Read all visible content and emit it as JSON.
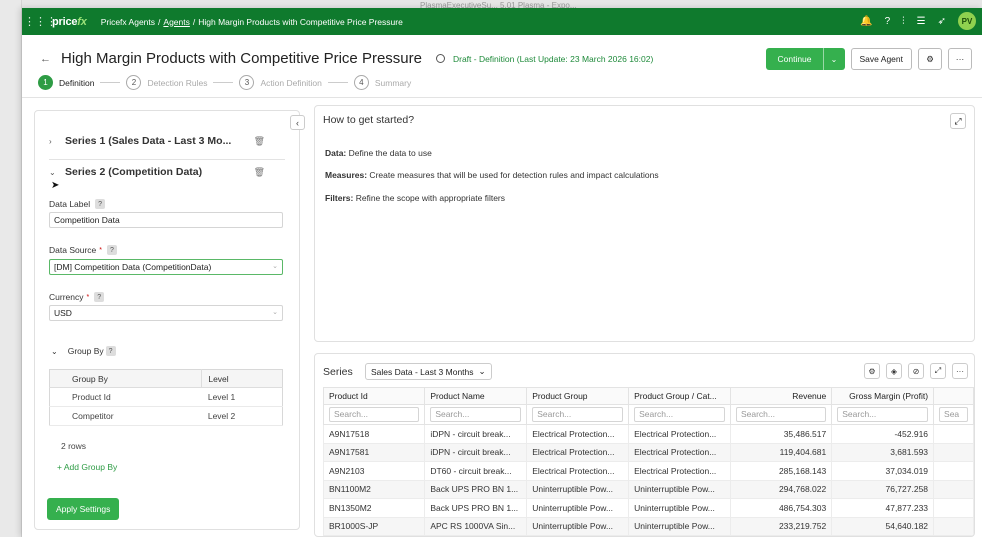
{
  "background_ghost_text": "PlasmaExecutiveSu...  5.01  Plasma - Expo...",
  "topbar": {
    "logo_main": "price",
    "logo_fx": "fx",
    "crumb_1": "Pricefx Agents",
    "crumb_sep1": "/",
    "crumb_2": "Agents",
    "crumb_sep2": "/",
    "crumb_3": "High Margin Products with Competitive Price Pressure",
    "avatar_initials": "PV",
    "icons": [
      "grid-icon",
      "bell-icon",
      "help-icon",
      "sliders-icon",
      "database-icon",
      "rocket-icon"
    ]
  },
  "header": {
    "title": "High Margin Products with Competitive Price Pressure",
    "status": "Draft - Definition (Last Update: 23 March 2026 16:02)",
    "continue_label": "Continue",
    "save_label": "Save Agent",
    "more_label": "···"
  },
  "steps": [
    {
      "num": "1",
      "label": "Definition"
    },
    {
      "num": "2",
      "label": "Detection Rules"
    },
    {
      "num": "3",
      "label": "Action Definition"
    },
    {
      "num": "4",
      "label": "Summary"
    }
  ],
  "left": {
    "series1_name": "Series 1 (Sales Data - Last 3 Mo...",
    "series2_name": "Series 2 (Competition Data)",
    "data_label_label": "Data Label",
    "data_label_value": "Competition Data",
    "data_source_label": "Data Source",
    "data_source_value": "[DM] Competition Data (CompetitionData)",
    "currency_label": "Currency",
    "currency_value": "USD",
    "group_by_label": "Group By",
    "gb_col1": "Group By",
    "gb_col2": "Level",
    "gb_rows": [
      {
        "group": "Product Id",
        "level": "Level 1"
      },
      {
        "group": "Competitor",
        "level": "Level 2"
      }
    ],
    "rows_count": "2 rows",
    "add_group": "+ Add Group By",
    "apply_label": "Apply Settings",
    "help_mark": "?",
    "req_mark": "*"
  },
  "guide": {
    "title": "How to get started?",
    "line1_bold": "Data:",
    "line1_text": " Define the data to use",
    "line2_bold": "Measures:",
    "line2_text": " Create measures that will be used for detection rules and impact calculations",
    "line3_bold": "Filters:",
    "line3_text": " Refine the scope with appropriate filters"
  },
  "series_panel": {
    "label": "Series",
    "selected": "Sales Data - Last 3 Months",
    "search_placeholder": "Search...",
    "columns": [
      "Product Id",
      "Product Name",
      "Product Group",
      "Product Group / Cat...",
      "Revenue",
      "Gross Margin (Profit)",
      "Sea"
    ],
    "rows": [
      [
        "A9N17518",
        "iDPN - circuit break...",
        "Electrical Protection...",
        "Electrical Protection...",
        "35,486.517",
        "-452.916"
      ],
      [
        "A9N17581",
        "iDPN - circuit break...",
        "Electrical Protection...",
        "Electrical Protection...",
        "119,404.681",
        "3,681.593"
      ],
      [
        "A9N2103",
        "DT60 - circuit break...",
        "Electrical Protection...",
        "Electrical Protection...",
        "285,168.143",
        "37,034.019"
      ],
      [
        "BN1100M2",
        "Back UPS PRO BN 1...",
        "Uninterruptible Pow...",
        "Uninterruptible Pow...",
        "294,768.022",
        "76,727.258"
      ],
      [
        "BN1350M2",
        "Back UPS PRO BN 1...",
        "Uninterruptible Pow...",
        "Uninterruptible Pow...",
        "486,754.303",
        "47,877.233"
      ],
      [
        "BR1000S-JP",
        "APC RS 1000VA Sin...",
        "Uninterruptible Pow...",
        "Uninterruptible Pow...",
        "233,219.752",
        "54,640.182"
      ]
    ]
  }
}
